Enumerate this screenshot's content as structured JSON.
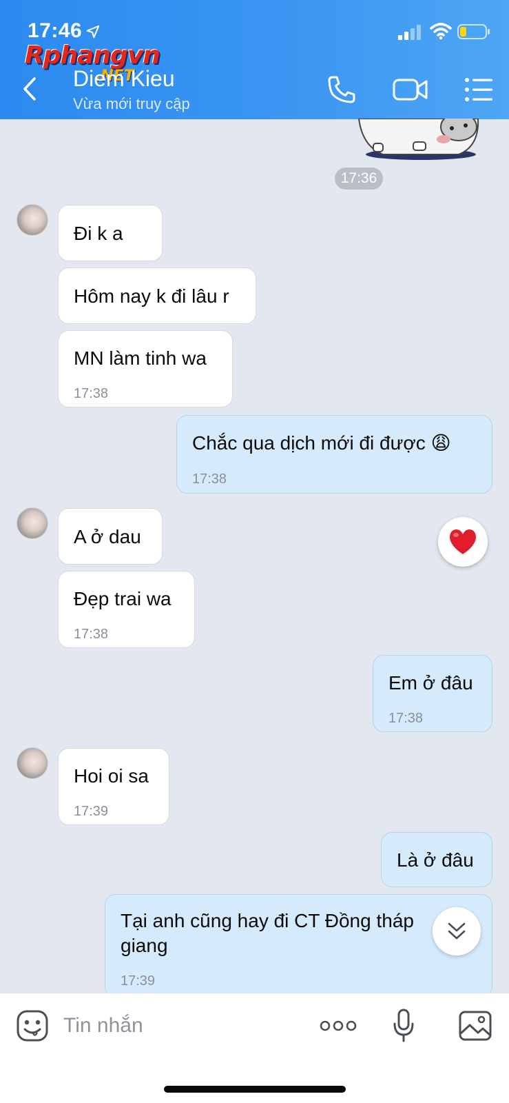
{
  "status_bar": {
    "time": "17:46"
  },
  "watermark": {
    "main": "Rphangvn",
    "sub": ".NET"
  },
  "header": {
    "contact_name": "Diem Kieu",
    "contact_status": "Vừa mới truy cập"
  },
  "sticker_time": "17:36",
  "messages": [
    {
      "dir": "in",
      "text": "Đi k a"
    },
    {
      "dir": "in",
      "text": "Hôm nay k đi lâu r"
    },
    {
      "dir": "in",
      "text": "MN làm tinh wa",
      "time": "17:38"
    },
    {
      "dir": "out",
      "text": "Chắc qua dịch mới đi được 😩",
      "time": "17:38"
    },
    {
      "dir": "in",
      "text": "A ở dau"
    },
    {
      "dir": "in",
      "text": "Đẹp trai wa",
      "time": "17:38"
    },
    {
      "dir": "out",
      "text": "Em ở đâu",
      "time": "17:38"
    },
    {
      "dir": "in",
      "text": "Hoi oi sa",
      "time": "17:39"
    },
    {
      "dir": "out",
      "text": "Là ở đâu"
    },
    {
      "dir": "out",
      "text_line1": "Tại anh cũng hay đi CT Đồng tháp",
      "text_line2": "giang",
      "time": "17:39"
    }
  ],
  "reaction": "❤️",
  "input": {
    "placeholder": "Tin nhắn"
  }
}
